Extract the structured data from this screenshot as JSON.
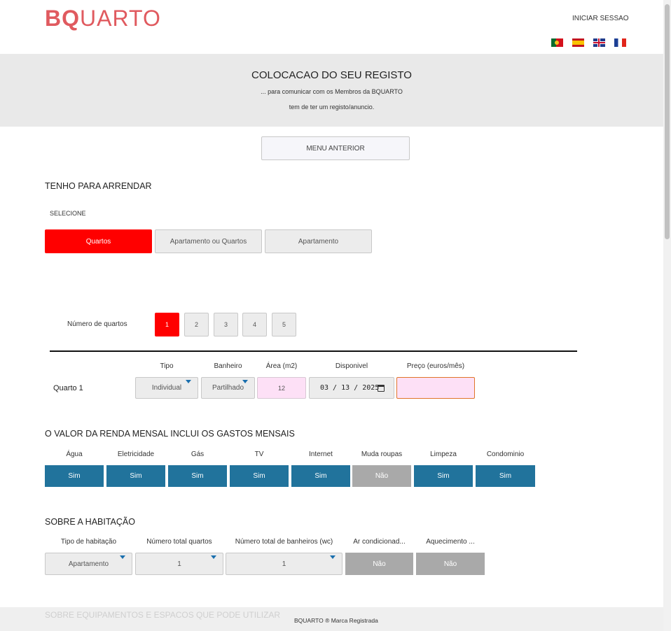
{
  "header": {
    "logo_bold": "BQ",
    "logo_rest": "UARTO",
    "login_label": "INICIAR SESSAO",
    "languages": [
      "pt-flag-icon",
      "es-flag-icon",
      "uk-flag-icon",
      "fr-flag-icon"
    ]
  },
  "banner": {
    "title": "COLOCACAO DO SEU REGISTO",
    "subtitle_1": "... para comunicar com os Membros da BQUARTO",
    "subtitle_2": "tem de ter um registo/anuncio."
  },
  "menu_button": "MENU ANTERIOR",
  "rent_section": {
    "title": "TENHO PARA ARRENDAR",
    "select_label": "SELECIONE",
    "options": [
      "Quartos",
      "Apartamento ou Quartos",
      "Apartamento"
    ],
    "selected": "Quartos"
  },
  "rooms": {
    "label": "Número de quartos",
    "numbers": [
      "1",
      "2",
      "3",
      "4",
      "5"
    ],
    "selected": "1"
  },
  "room_table": {
    "headers": {
      "tipo": "Tipo",
      "banheiro": "Banheiro",
      "area": "Área (m2)",
      "disponivel": "Disponivel",
      "preco": "Preço (euros/mês)"
    },
    "row": {
      "label": "Quarto 1",
      "tipo": "Individual",
      "banheiro": "Partilhado",
      "area": "12",
      "disponivel": "03 / 13 / 2025",
      "preco": ""
    }
  },
  "utilities": {
    "title": "O VALOR DA RENDA MENSAL INCLUI OS GASTOS MENSAIS",
    "items": [
      {
        "label": "Água",
        "value": "Sim"
      },
      {
        "label": "Eletricidade",
        "value": "Sim"
      },
      {
        "label": "Gás",
        "value": "Sim"
      },
      {
        "label": "TV",
        "value": "Sim"
      },
      {
        "label": "Internet",
        "value": "Sim"
      },
      {
        "label": "Muda roupas",
        "value": "Não"
      },
      {
        "label": "Limpeza",
        "value": "Sim"
      },
      {
        "label": "Condominio",
        "value": "Sim"
      }
    ]
  },
  "habitacao": {
    "title": "SOBRE A HABITAÇÃO",
    "headers": {
      "tipo": "Tipo de habitação",
      "quartos": "Número total quartos",
      "banheiros": "Número total de banheiros (wc)",
      "ar": "Ar condicionad...",
      "aquecimento": "Aquecimento ..."
    },
    "values": {
      "tipo": "Apartamento",
      "quartos": "1",
      "banheiros": "1",
      "ar": "Não",
      "aquecimento": "Não"
    }
  },
  "footer": {
    "next_section": "SOBRE EQUIPAMENTOS E ESPACOS QUE PODE UTILIZAR",
    "brand": "BQUARTO ® Marca Registrada"
  },
  "colors": {
    "brand": "#e05a5f",
    "selected_red": "#ff0000",
    "yes_blue": "#21739c",
    "no_grey": "#a9a9a9"
  }
}
